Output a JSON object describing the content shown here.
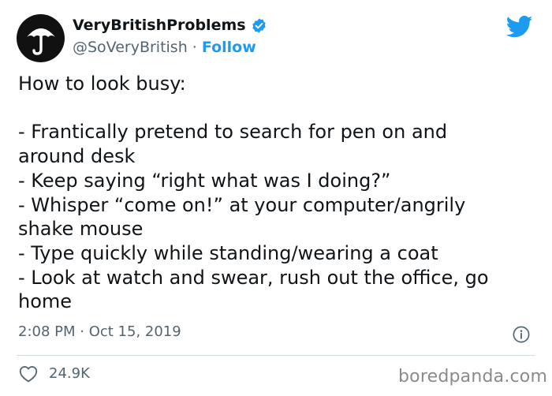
{
  "author": {
    "display_name": "VeryBritishProblems",
    "handle": "@SoVeryBritish",
    "separator": " · ",
    "follow_label": "Follow",
    "verified_icon": "verified-badge-icon",
    "avatar_icon": "umbrella-icon"
  },
  "tweet": {
    "text": "How to look busy:\n\n- Frantically pretend to search for pen on and\naround desk\n- Keep saying “right what was I doing?”\n- Whisper “come on!” at your computer/angrily\nshake mouse\n- Type quickly while standing/wearing a coat\n- Look at watch and swear, rush out the office, go\nhome",
    "timestamp": "2:08 PM · Oct 15, 2019"
  },
  "engagement": {
    "like_count": "24.9K",
    "like_icon": "heart-icon",
    "info_icon": "info-icon"
  },
  "watermark": "boredpanda.com",
  "colors": {
    "accent": "#1d9bf0",
    "text": "#0f1419",
    "secondary": "#536471",
    "divider": "#cfd9de"
  }
}
